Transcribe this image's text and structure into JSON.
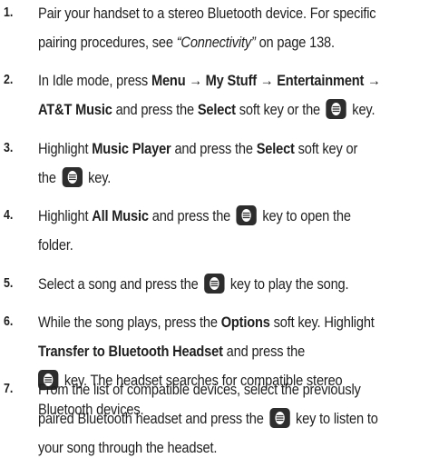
{
  "key_icon_name": "select-key-icon",
  "steps": [
    {
      "num": "1.",
      "l1": [
        "Pair your handset to a stereo Bluetooth device. For specific"
      ],
      "l2": [
        "pairing procedures, see ",
        "“Connectivity”",
        " on page 138."
      ]
    },
    {
      "num": "2.",
      "l1": [
        "In Idle mode, press ",
        "Menu → My Stuff → Entertainment →"
      ],
      "l2": [
        "AT&T Music",
        " and press the ",
        "Select",
        " soft key or the ",
        " key."
      ]
    },
    {
      "num": "3.",
      "l1": [
        "Highlight ",
        "Music Player",
        " and press the ",
        "Select",
        " soft key or"
      ],
      "l2": [
        "the ",
        " key."
      ]
    },
    {
      "num": "4.",
      "l1": [
        "Highlight ",
        "All Music",
        " and press the ",
        " key to open the"
      ],
      "l2": [
        "folder."
      ]
    },
    {
      "num": "5.",
      "l1": [
        "Select a song and press the ",
        " key to play the song."
      ]
    },
    {
      "num": "6.",
      "l1": [
        "While the song plays, press the ",
        "Options",
        " soft key. Highlight"
      ],
      "l2": [
        "Transfer to Bluetooth Headset",
        " and press the"
      ],
      "l3": [
        " key. The headset searches for compatible stereo"
      ],
      "l4": [
        "Bluetooth devices."
      ]
    },
    {
      "num": "7.",
      "l1": [
        "From the list of compatible devices, select the previously"
      ],
      "l2": [
        "paired Bluetooth headset and press the ",
        " key to listen to"
      ],
      "l3": [
        "your song through the headset."
      ]
    }
  ]
}
